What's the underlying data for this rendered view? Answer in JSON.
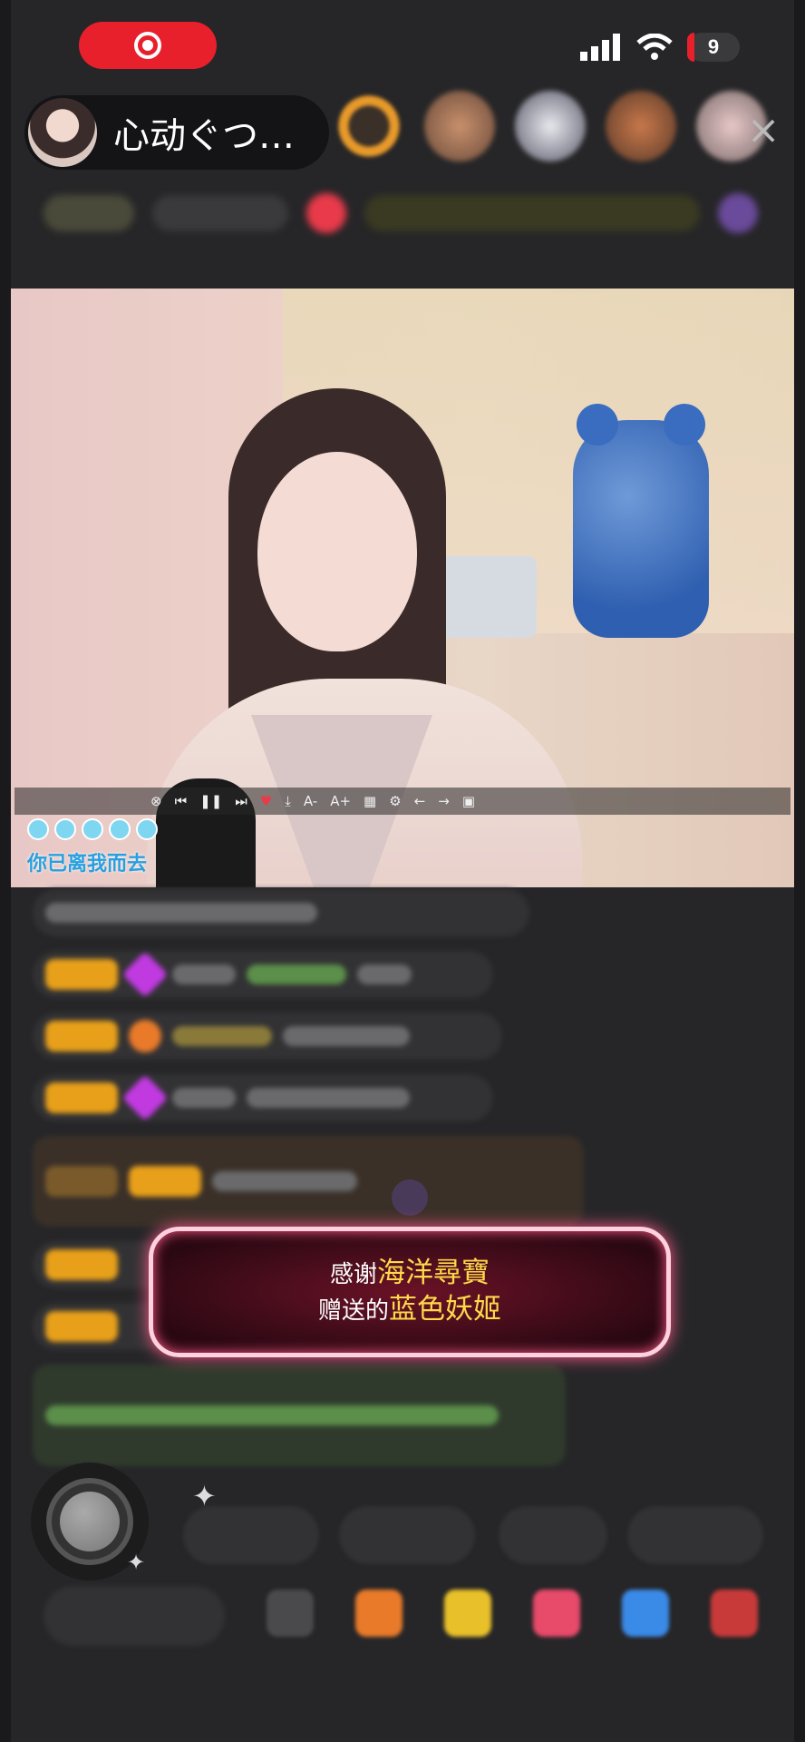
{
  "status_bar": {
    "battery_level": "9",
    "colors": {
      "record": "#e8202c",
      "battery_accent": "#e8202c"
    }
  },
  "header": {
    "host_name": "心动ぐつ…",
    "close_icon": "close-icon"
  },
  "video": {
    "lyric": "你已离我而去",
    "player_icons": [
      "close-icon",
      "prev-icon",
      "pause-icon",
      "next-icon",
      "heart-icon",
      "download-icon",
      "font-smaller-icon",
      "font-larger-icon",
      "list-icon",
      "settings-icon",
      "back-icon",
      "forward-icon",
      "lock-icon"
    ]
  },
  "gift_toast": {
    "thanks_prefix": "感谢",
    "sender": "海洋尋寶",
    "gift_prefix": "赠送的",
    "gift_name": "蓝色妖姬",
    "colors": {
      "highlight": "#ffd84a",
      "border": "#ffd0de",
      "glow": "#ff5a8a"
    }
  },
  "bottom": {
    "record_icon": "record-button-icon",
    "tool_icons": [
      "emoji-icon",
      "gift-box-icon",
      "treasure-icon",
      "heart-gift-icon",
      "game-icon",
      "more-gift-icon"
    ]
  }
}
